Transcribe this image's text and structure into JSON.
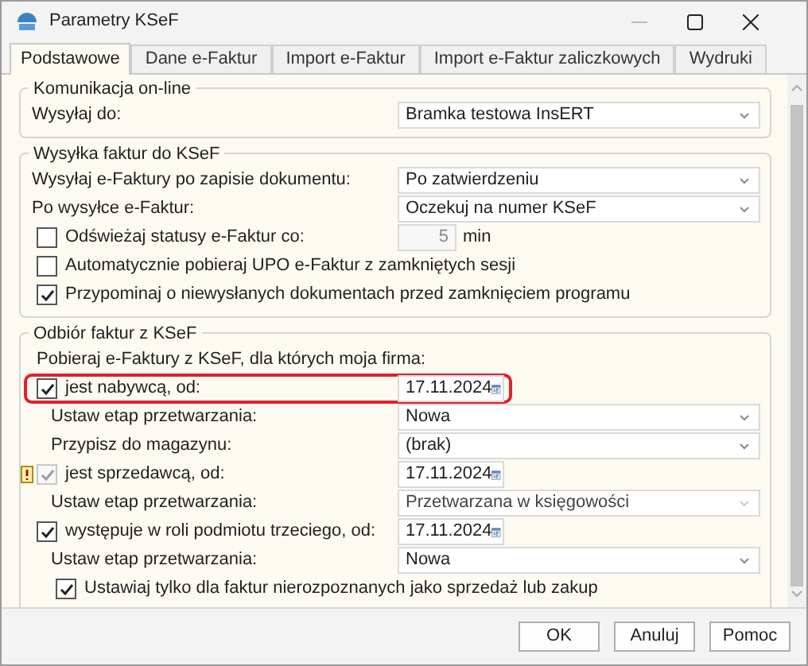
{
  "window": {
    "title": "Parametry KSeF"
  },
  "tabs": [
    {
      "label": "Podstawowe",
      "selected": true
    },
    {
      "label": "Dane e-Faktur",
      "selected": false
    },
    {
      "label": "Import e-Faktur",
      "selected": false
    },
    {
      "label": "Import e-Faktur zaliczkowych",
      "selected": false
    },
    {
      "label": "Wydruki",
      "selected": false
    }
  ],
  "groups": [
    {
      "title": "Komunikacja on-line",
      "rows": [
        {
          "kind": "select",
          "label": "Wysyłaj do:",
          "value": "Bramka testowa InsERT",
          "disabled": false
        }
      ]
    },
    {
      "title": "Wysyłka faktur do KSeF",
      "rows": [
        {
          "kind": "select",
          "label": "Wysyłaj e-Faktury po zapisie dokumentu:",
          "value": "Po zatwierdzeniu",
          "disabled": false
        },
        {
          "kind": "select",
          "label": "Po wysyłce e-Faktur:",
          "value": "Oczekuj na numer KSeF",
          "disabled": false
        },
        {
          "kind": "check_number",
          "label": "Odświeżaj statusy e-Faktur co:",
          "checked": false,
          "value": "5",
          "unit": "min",
          "disabled": true
        },
        {
          "kind": "check",
          "label": "Automatycznie pobieraj UPO e-Faktur z zamkniętych sesji",
          "checked": false,
          "disabled": false
        },
        {
          "kind": "check",
          "label": "Przypominaj o niewysłanych dokumentach przed zamknięciem programu",
          "checked": true,
          "disabled": false
        }
      ]
    },
    {
      "title": "Odbiór faktur z KSeF",
      "rows": [
        {
          "kind": "text",
          "label": "Pobieraj e-Faktury z KSeF, dla których moja firma:"
        },
        {
          "kind": "check_date",
          "label": "jest nabywcą, od:",
          "checked": true,
          "disabled": false,
          "warning": false,
          "highlighted": true,
          "value": "17.11.2024",
          "children": [
            {
              "kind": "select",
              "label": "Ustaw etap przetwarzania:",
              "value": "Nowa",
              "disabled": false
            },
            {
              "kind": "select",
              "label": "Przypisz do magazynu:",
              "value": "(brak)",
              "disabled": false
            }
          ]
        },
        {
          "kind": "check_date",
          "label": "jest sprzedawcą, od:",
          "checked": true,
          "disabled": true,
          "warning": true,
          "highlighted": false,
          "value": "17.11.2024",
          "children": [
            {
              "kind": "select",
              "label": "Ustaw etap przetwarzania:",
              "value": "Przetwarzana w księgowości",
              "disabled": true
            }
          ]
        },
        {
          "kind": "check_date",
          "label": "występuje w roli podmiotu trzeciego, od:",
          "checked": true,
          "disabled": false,
          "warning": false,
          "highlighted": false,
          "value": "17.11.2024",
          "children": [
            {
              "kind": "select",
              "label": "Ustaw etap przetwarzania:",
              "value": "Nowa",
              "disabled": false
            },
            {
              "kind": "check",
              "label": "Ustawiaj tylko dla faktur nierozpoznanych jako sprzedaż lub zakup",
              "checked": true,
              "disabled": false
            }
          ]
        }
      ]
    }
  ],
  "buttons": [
    "OK",
    "Anuluj",
    "Pomoc"
  ]
}
